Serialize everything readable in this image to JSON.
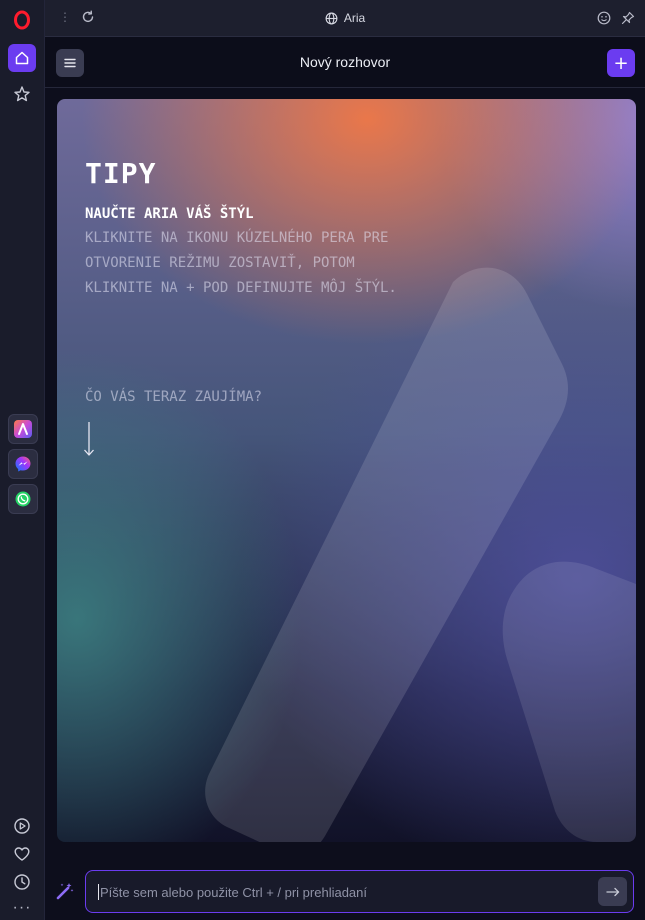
{
  "window": {
    "title": "Aria"
  },
  "sidebar": {
    "items": [
      {
        "name": "home",
        "icon": "home-icon"
      },
      {
        "name": "speed-dial",
        "icon": "star-icon"
      },
      {
        "name": "aria",
        "icon": "aria-icon"
      },
      {
        "name": "messenger",
        "icon": "messenger-icon"
      },
      {
        "name": "whatsapp",
        "icon": "whatsapp-icon"
      },
      {
        "name": "player",
        "icon": "play-icon"
      },
      {
        "name": "favorites",
        "icon": "heart-icon"
      },
      {
        "name": "history",
        "icon": "history-icon"
      }
    ],
    "more_label": "···"
  },
  "header": {
    "title": "Nový rozhovor",
    "new_chat_label": "+"
  },
  "tips": {
    "title": "TIPY",
    "subtitle": "Naučte Aria váš štýl",
    "body": "Kliknite na ikonu kúzelného pera pre otvorenie režimu Zostaviť, potom kliknite na + pod Definujte môj štýl.",
    "question": "Čo vás teraz zaujíma?"
  },
  "composer": {
    "placeholder": "Píšte sem alebo použite Ctrl + / pri prehliadaní",
    "value": ""
  },
  "colors": {
    "accent": "#6b3cf0",
    "background": "#0d0e1c",
    "sidebar": "#1a1c2b"
  }
}
